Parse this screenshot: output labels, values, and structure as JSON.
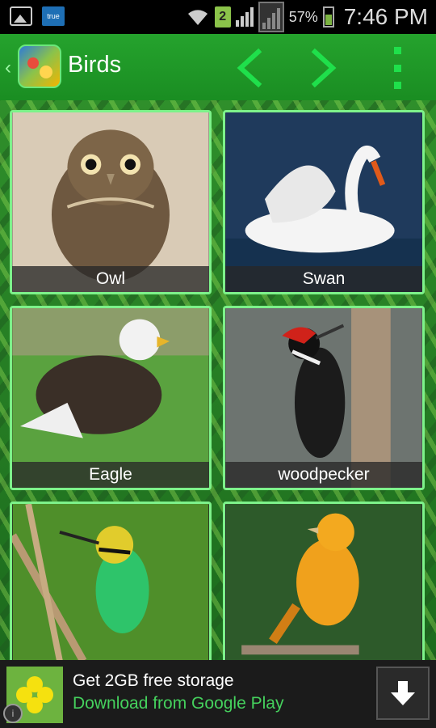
{
  "status_bar": {
    "carrier_badge": "true",
    "sim_slot": "2",
    "battery_percent": "57%",
    "time": "7:46 PM",
    "icons": [
      "gallery-icon",
      "true-badge-icon",
      "wifi-icon",
      "sim-icon",
      "signal-icon",
      "signal-secondary-icon",
      "battery-icon"
    ]
  },
  "action_bar": {
    "title": "Birds",
    "icons": [
      "up-caret-icon",
      "app-icon",
      "prev-arrow-icon",
      "next-arrow-icon",
      "overflow-menu-icon"
    ],
    "accent_color": "#1fe04b"
  },
  "birds": [
    {
      "caption": "Owl"
    },
    {
      "caption": "Swan"
    },
    {
      "caption": "Eagle"
    },
    {
      "caption": "woodpecker"
    },
    {
      "caption": ""
    },
    {
      "caption": ""
    }
  ],
  "ad": {
    "line1": "Get 2GB free storage",
    "line2": "Download from Google Play",
    "icons": [
      "drive-logo-icon",
      "info-icon",
      "download-arrow-icon"
    ],
    "line2_color": "#45d15d"
  }
}
